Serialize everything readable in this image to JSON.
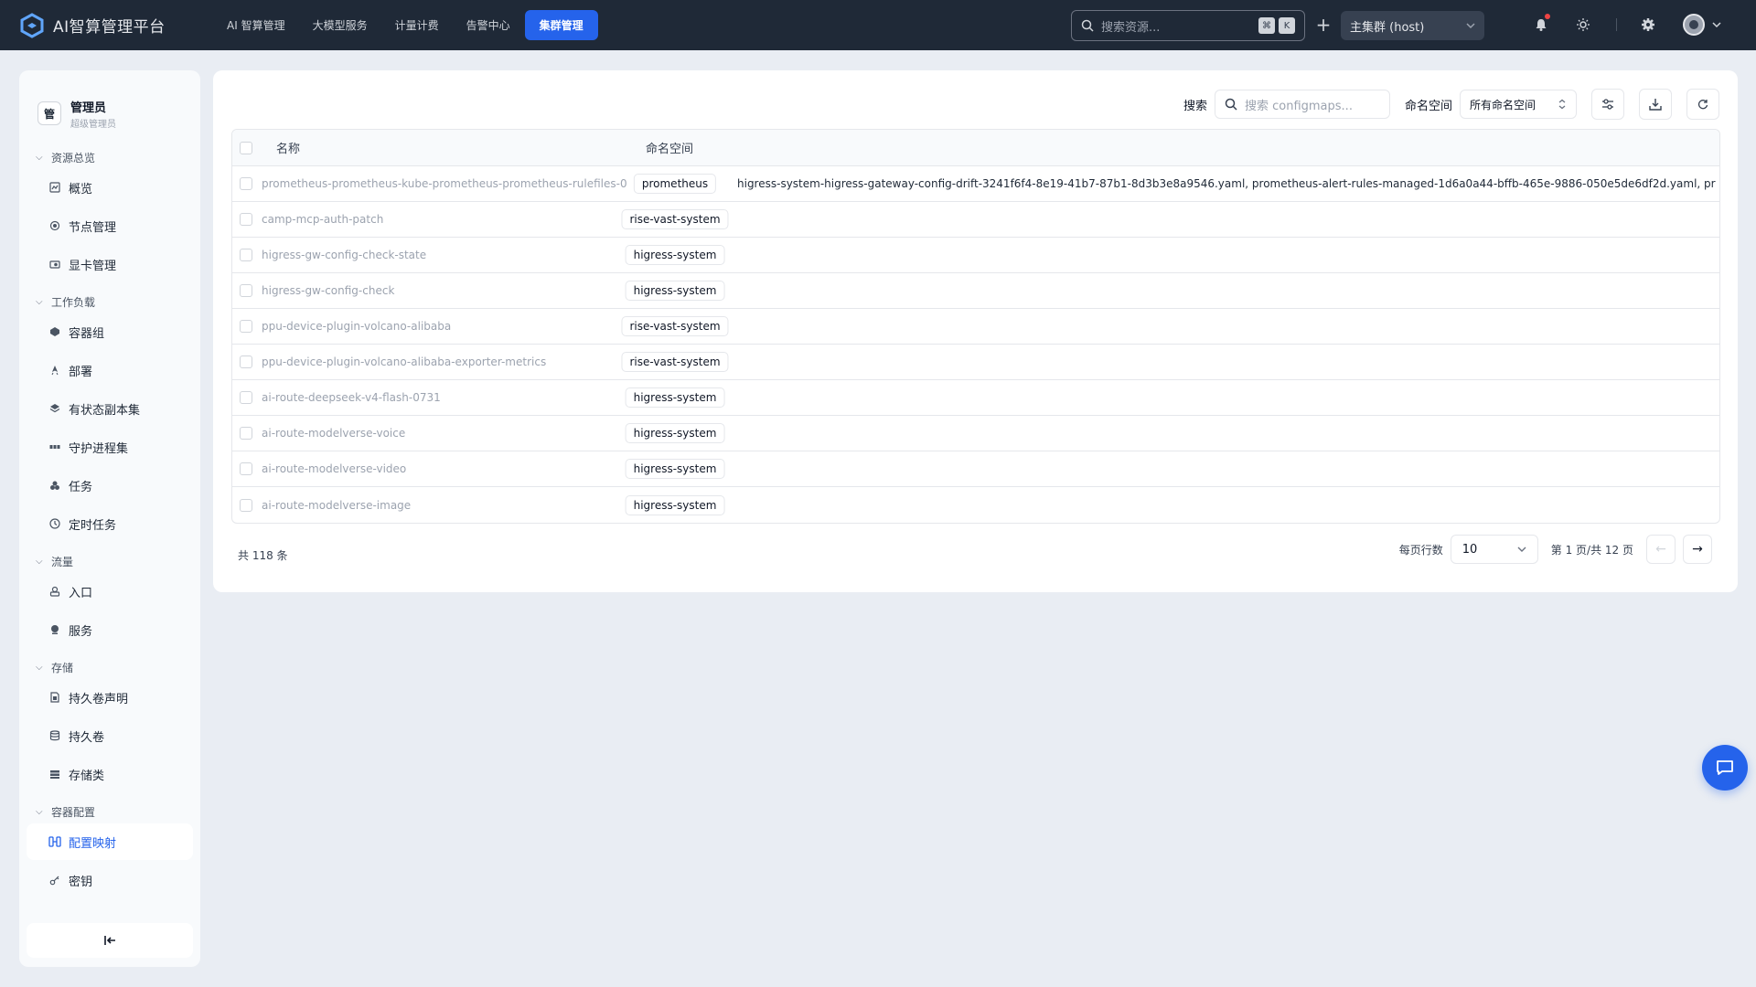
{
  "app": {
    "title": "AI智算管理平台"
  },
  "nav": {
    "items": [
      {
        "label": "AI 智算管理",
        "active": false
      },
      {
        "label": "大模型服务",
        "active": false
      },
      {
        "label": "计量计费",
        "active": false
      },
      {
        "label": "告警中心",
        "active": false
      },
      {
        "label": "集群管理",
        "active": true
      }
    ]
  },
  "topbar": {
    "search_placeholder": "搜索资源...",
    "kbd_1": "⌘",
    "kbd_2": "K",
    "cluster": "主集群 (host)"
  },
  "user": {
    "avatar_text": "管",
    "name": "管理员",
    "role": "超级管理员"
  },
  "sidebar": {
    "groups": [
      {
        "label": "资源总览",
        "items": [
          {
            "label": "概览",
            "icon": "dashboard-icon"
          },
          {
            "label": "节点管理",
            "icon": "node-icon"
          },
          {
            "label": "显卡管理",
            "icon": "gpu-icon"
          }
        ]
      },
      {
        "label": "工作负载",
        "items": [
          {
            "label": "容器组",
            "icon": "pod-icon"
          },
          {
            "label": "部署",
            "icon": "deploy-icon"
          },
          {
            "label": "有状态副本集",
            "icon": "layers-icon"
          },
          {
            "label": "守护进程集",
            "icon": "daemon-icon"
          },
          {
            "label": "任务",
            "icon": "job-icon"
          },
          {
            "label": "定时任务",
            "icon": "clock-icon"
          }
        ]
      },
      {
        "label": "流量",
        "items": [
          {
            "label": "入口",
            "icon": "ingress-icon"
          },
          {
            "label": "服务",
            "icon": "service-icon"
          }
        ]
      },
      {
        "label": "存储",
        "items": [
          {
            "label": "持久卷声明",
            "icon": "file-icon"
          },
          {
            "label": "持久卷",
            "icon": "database-icon"
          },
          {
            "label": "存储类",
            "icon": "storage-class-icon"
          }
        ]
      },
      {
        "label": "容器配置",
        "items": [
          {
            "label": "配置映射",
            "icon": "configmap-icon",
            "active": true
          },
          {
            "label": "密钥",
            "icon": "key-icon"
          }
        ]
      }
    ]
  },
  "toolbar": {
    "search_label": "搜索",
    "search_placeholder": "搜索 configmaps...",
    "ns_label": "命名空间",
    "ns_value": "所有命名空间"
  },
  "table": {
    "headers": {
      "name": "名称",
      "namespace": "命名空间"
    },
    "rows": [
      {
        "name": "prometheus-prometheus-kube-prometheus-prometheus-rulefiles-0",
        "namespace": "prometheus",
        "data": "higress-system-higress-gateway-config-drift-3241f6f4-8e19-41b7-87b1-8d3b3e8a9546.yaml, prometheus-alert-rules-managed-1d6a0a44-bffb-465e-9886-050e5de6df2d.yaml, prometheus-prometheus-ku"
      },
      {
        "name": "camp-mcp-auth-patch",
        "namespace": "rise-vast-system",
        "data": ""
      },
      {
        "name": "higress-gw-config-check-state",
        "namespace": "higress-system",
        "data": ""
      },
      {
        "name": "higress-gw-config-check",
        "namespace": "higress-system",
        "data": ""
      },
      {
        "name": "ppu-device-plugin-volcano-alibaba",
        "namespace": "rise-vast-system",
        "data": ""
      },
      {
        "name": "ppu-device-plugin-volcano-alibaba-exporter-metrics",
        "namespace": "rise-vast-system",
        "data": ""
      },
      {
        "name": "ai-route-deepseek-v4-flash-0731",
        "namespace": "higress-system",
        "data": ""
      },
      {
        "name": "ai-route-modelverse-voice",
        "namespace": "higress-system",
        "data": ""
      },
      {
        "name": "ai-route-modelverse-video",
        "namespace": "higress-system",
        "data": ""
      },
      {
        "name": "ai-route-modelverse-image",
        "namespace": "higress-system",
        "data": ""
      }
    ]
  },
  "footer": {
    "total": "共 118 条",
    "rows_per_page_label": "每页行数",
    "rows_per_page": "10",
    "page_info": "第 1 页/共 12 页",
    "prev": "←",
    "next": "→"
  },
  "colors": {
    "accent": "#2563eb",
    "topbar": "#1f2937",
    "background": "#e9edf3"
  }
}
